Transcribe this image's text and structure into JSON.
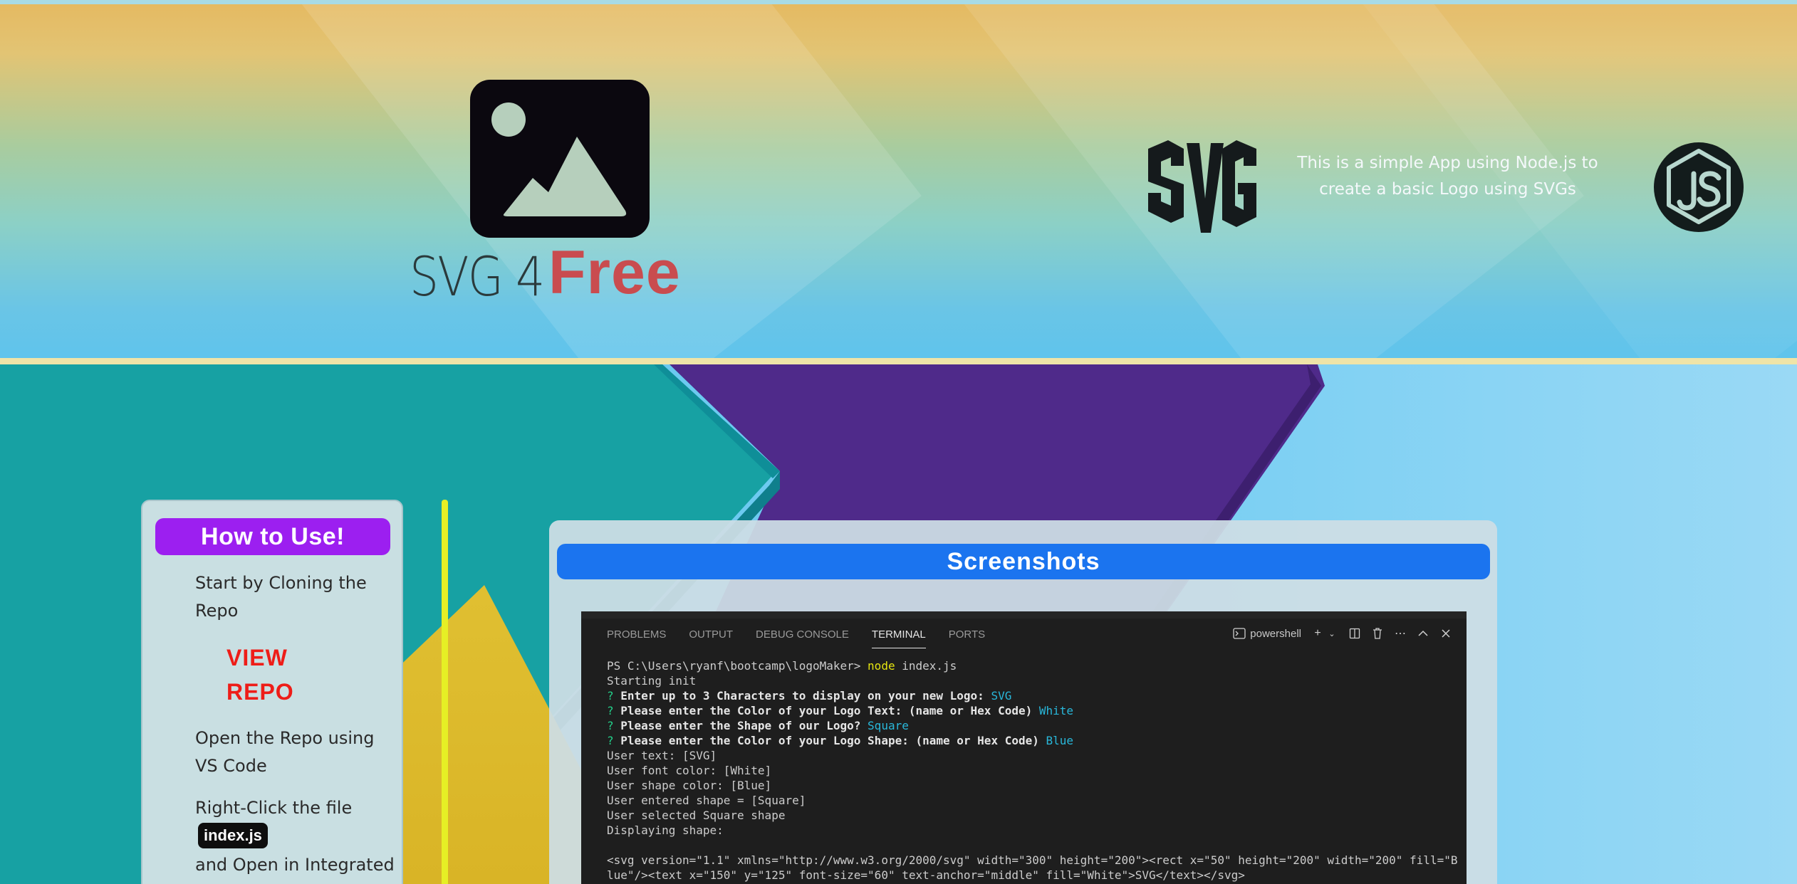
{
  "header": {
    "brand_prefix": "SVG 4",
    "brand_highlight": "Free",
    "tagline": "This is a simple App using Node.js to create a basic Logo using SVGs",
    "icons": [
      "image-placeholder-icon",
      "svg-logo-icon",
      "nodejs-logo-icon"
    ]
  },
  "howto": {
    "title": "How to Use!",
    "step1": "Start by Cloning the Repo",
    "view_repo": "VIEW REPO",
    "step2": "Open the Repo using VS Code",
    "step3a": "Right-Click the file",
    "file": "index.js",
    "step3b": "and Open in Integrated"
  },
  "screenshots": {
    "title": "Screenshots",
    "terminal": {
      "tabs": [
        "PROBLEMS",
        "OUTPUT",
        "DEBUG CONSOLE",
        "TERMINAL",
        "PORTS"
      ],
      "active_tab": "TERMINAL",
      "shell": "powershell",
      "prompt": "PS C:\\Users\\ryanf\\bootcamp\\logoMaker> ",
      "command": "node",
      "command_args": " index.js",
      "line_init": "Starting init",
      "q1": "Enter up to 3 Characters to display on your new Logo: ",
      "a1": "SVG",
      "q2": "Please enter the Color of your Logo Text: (name or Hex Code) ",
      "a2": "White",
      "q3": "Please enter the Shape of our Logo? ",
      "a3": "Square",
      "q4": "Please enter the Color of your Logo Shape: (name or Hex Code) ",
      "a4": "Blue",
      "out1": "User text: [SVG]",
      "out2": "User font color: [White]",
      "out3": "User shape color: [Blue]",
      "out4": "User entered shape = [Square]",
      "out5": "User selected Square shape",
      "out6": "Displaying shape:",
      "svg_line1": "<svg version=\"1.1\" xmlns=\"http://www.w3.org/2000/svg\" width=\"300\" height=\"200\"><rect x=\"50\" height=\"200\" width=\"200\" fill=\"B",
      "svg_line2": "lue\"/><text x=\"150\" y=\"125\" font-size=\"60\" text-anchor=\"middle\" fill=\"White\">SVG</text></svg>"
    }
  },
  "colors": {
    "accent_purple": "#9c1ff0",
    "accent_blue": "#1b74ef",
    "brand_red": "#c94c4f",
    "link_red": "#ee1d18"
  }
}
